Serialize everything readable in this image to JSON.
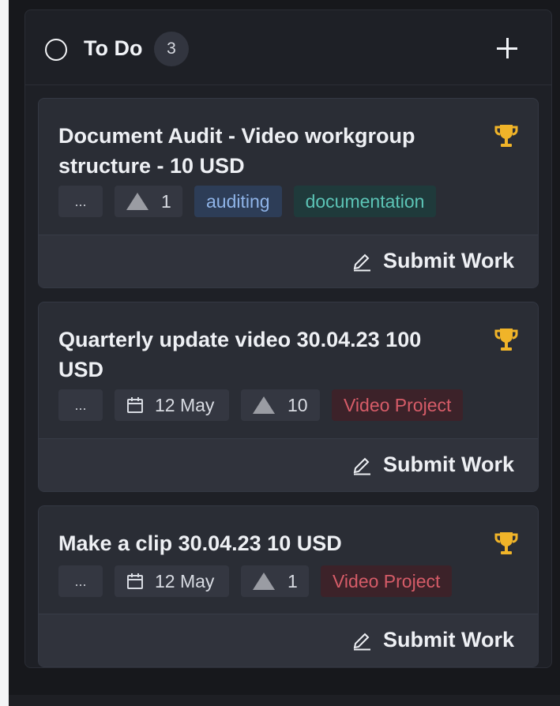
{
  "column": {
    "title": "To Do",
    "count": "3"
  },
  "cards": [
    {
      "title": "Document Audit - Video workgroup structure - 10 USD",
      "more": "...",
      "points": "1",
      "tags": [
        "auditing",
        "documentation"
      ],
      "submit": "Submit Work"
    },
    {
      "title": "Quarterly update video 30.04.23 100 USD",
      "more": "...",
      "date": "12 May",
      "points": "10",
      "tags": [
        "Video Project"
      ],
      "submit": "Submit Work"
    },
    {
      "title": "Make a clip 30.04.23 10 USD",
      "more": "...",
      "date": "12 May",
      "points": "1",
      "tags": [
        "Video Project"
      ],
      "submit": "Submit Work"
    }
  ],
  "icons": {
    "status": "circle-icon",
    "add": "plus-icon",
    "reward": "trophy-icon",
    "points": "triangle-icon",
    "date": "calendar-icon",
    "edit": "pencil-icon"
  },
  "colors": {
    "trophy": "#f0b429",
    "tag_blue": "#8fb4e8",
    "tag_teal": "#5cc4b6",
    "tag_red": "#d65c68"
  }
}
